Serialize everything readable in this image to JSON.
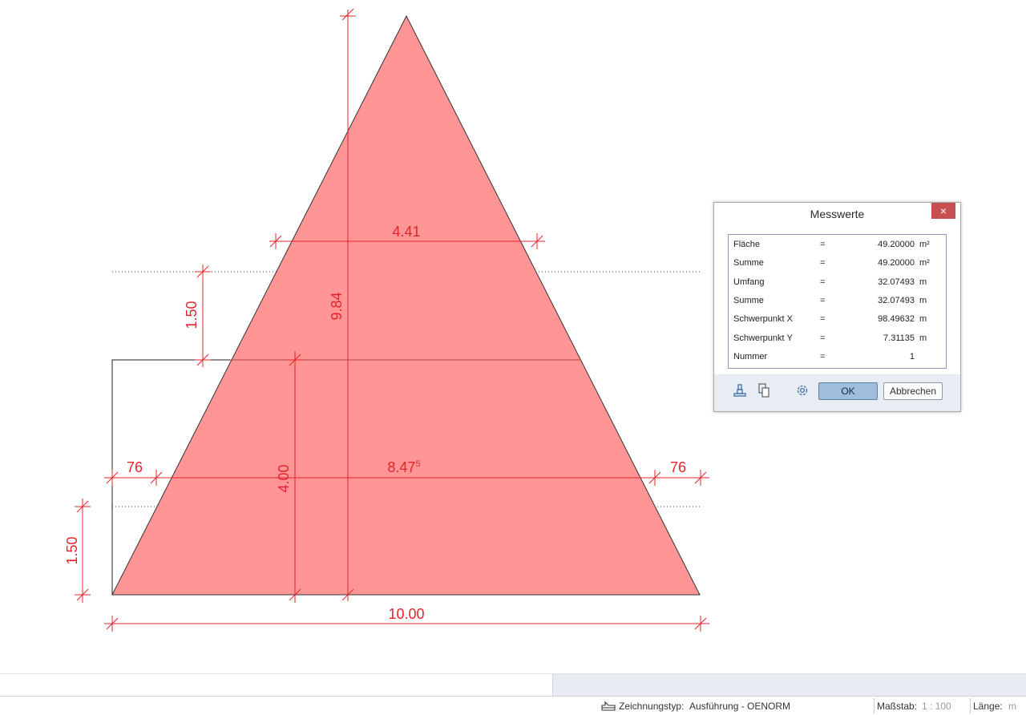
{
  "dimensions": {
    "top_width": "4.41",
    "height_total": "9.84",
    "spacing_upper": "1.50",
    "height_lower": "4.00",
    "mid_width_main": "8.47",
    "mid_width_sup": "5",
    "side_left": "76",
    "side_right": "76",
    "spacing_lower": "1.50",
    "base_width": "10.00"
  },
  "dialog": {
    "title": "Messwerte",
    "close_glyph": "×",
    "rows": [
      {
        "label": "Fläche",
        "eq": "=",
        "value": "49.20000",
        "unit": "m²"
      },
      {
        "label": "Summe",
        "eq": "=",
        "value": "49.20000",
        "unit": "m²"
      },
      {
        "label": "Umfang",
        "eq": "=",
        "value": "32.07493",
        "unit": "m"
      },
      {
        "label": "Summe",
        "eq": "=",
        "value": "32.07493",
        "unit": "m"
      },
      {
        "label": "Schwerpunkt X",
        "eq": "=",
        "value": "98.49632",
        "unit": "m"
      },
      {
        "label": "Schwerpunkt Y",
        "eq": "=",
        "value": "7.31135",
        "unit": "m"
      },
      {
        "label": "Nummer",
        "eq": "=",
        "value": "1",
        "unit": ""
      }
    ],
    "ok_label": "OK",
    "cancel_label": "Abbrechen",
    "icons": [
      "stamp-icon",
      "copy-icon",
      "settings-icon"
    ]
  },
  "statusbar": {
    "drawing_type_label": "Zeichnungstyp:",
    "drawing_type_value": "Ausführung - OENORM",
    "scale_label": "Maßstab:",
    "scale_value": "1 : 100",
    "length_label": "Länge:",
    "length_value": "m"
  },
  "colors": {
    "fill": "#ff9595",
    "dimension": "#e4242b",
    "accent_button": "#9fbddd",
    "close_button": "#c75050"
  }
}
